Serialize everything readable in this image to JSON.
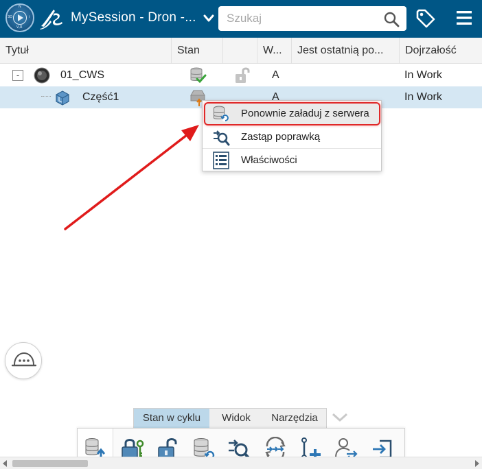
{
  "topbar": {
    "compass_icon": "3d-compass-icon",
    "compass_letters": {
      "top": "N",
      "left": "3D",
      "right": "i",
      "bottom": "V,R"
    },
    "logo_icon": "3ds-logo-icon",
    "title": "MySession - Dron -...",
    "title_chevron_icon": "chevron-down-icon",
    "search": {
      "placeholder": "Szukaj",
      "value": ""
    },
    "search_icon": "search-icon",
    "tag_icon": "tag-icon",
    "menu_icon": "hamburger-menu-icon",
    "background_color": "#005686"
  },
  "table": {
    "columns": [
      "Tytuł",
      "Stan",
      "",
      "W...",
      "Jest ostatnią po...",
      "Dojrzałość"
    ],
    "rows": [
      {
        "expander": "-",
        "title": "01_CWS",
        "icon": "assembly-icon",
        "state_icon": "database-check-icon",
        "lock_icon": "unlock-icon",
        "revision": "A",
        "is_latest": "",
        "maturity": "In Work"
      },
      {
        "title": "Część1",
        "icon": "part-icon",
        "state_icon": "modified-upload-icon",
        "revision": "A",
        "is_latest": "",
        "maturity": "In Work",
        "selected": true
      }
    ]
  },
  "context_menu": {
    "items": [
      {
        "label": "Ponownie załaduj z serwera",
        "icon": "reload-from-server-icon",
        "highlighted": true
      },
      {
        "label": "Zastąp poprawką",
        "icon": "replace-revision-icon"
      },
      {
        "label": "Właściwości",
        "icon": "properties-icon"
      }
    ],
    "highlight_color": "#e02828"
  },
  "floating_button": {
    "icon": "hard-hat-more-icon"
  },
  "action_bar": {
    "tabs": [
      {
        "label": "Stan w cyklu",
        "active": true
      },
      {
        "label": "Widok",
        "active": false
      },
      {
        "label": "Narzędzia",
        "active": false
      }
    ],
    "collapse_icon": "chevron-down-icon",
    "tools": [
      {
        "name": "save-to-server-icon"
      },
      {
        "name": "lock-key-icon"
      },
      {
        "name": "unlock-icon"
      },
      {
        "name": "reload-from-server-icon"
      },
      {
        "name": "replace-revision-icon"
      },
      {
        "name": "sync-icon"
      },
      {
        "name": "add-link-icon"
      },
      {
        "name": "transfer-ownership-icon"
      },
      {
        "name": "export-icon"
      }
    ]
  },
  "annotation": {
    "arrow_color": "#e01b1b"
  }
}
